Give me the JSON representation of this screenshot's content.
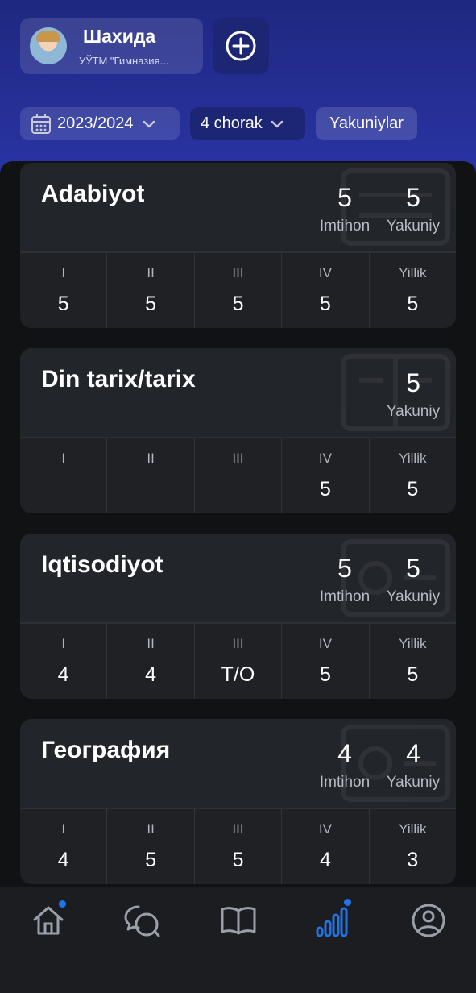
{
  "profile": {
    "name": "Шахида",
    "school": "УЎТМ \"Гимназия..."
  },
  "filters": {
    "year": "2023/2024",
    "quarter": "4 chorak",
    "final": "Yakuniylar"
  },
  "labels": {
    "exam": "Imtihon",
    "final": "Yakuniy"
  },
  "quarter_headers": [
    "I",
    "II",
    "III",
    "IV",
    "Yillik"
  ],
  "subjects": [
    {
      "name": "Adabiyot",
      "exam": "5",
      "final": "5",
      "grades": [
        "5",
        "5",
        "5",
        "5",
        "5"
      ]
    },
    {
      "name": "Din tarix/tarix",
      "exam": "",
      "final": "5",
      "grades": [
        "",
        "",
        "",
        "5",
        "5"
      ]
    },
    {
      "name": "Iqtisodiyot",
      "exam": "5",
      "final": "5",
      "grades": [
        "4",
        "4",
        "T/O",
        "5",
        "5"
      ]
    },
    {
      "name": "География",
      "exam": "4",
      "final": "4",
      "grades": [
        "4",
        "5",
        "5",
        "4",
        "3"
      ]
    }
  ],
  "nav": [
    {
      "icon": "home-icon",
      "active": false,
      "badge": true
    },
    {
      "icon": "chat-icon",
      "active": false,
      "badge": false
    },
    {
      "icon": "book-icon",
      "active": false,
      "badge": false
    },
    {
      "icon": "stats-icon",
      "active": true,
      "badge": true
    },
    {
      "icon": "profile-icon",
      "active": false,
      "badge": false
    }
  ],
  "colors": {
    "accent": "#1f74e8",
    "header": "#2a35a8"
  }
}
